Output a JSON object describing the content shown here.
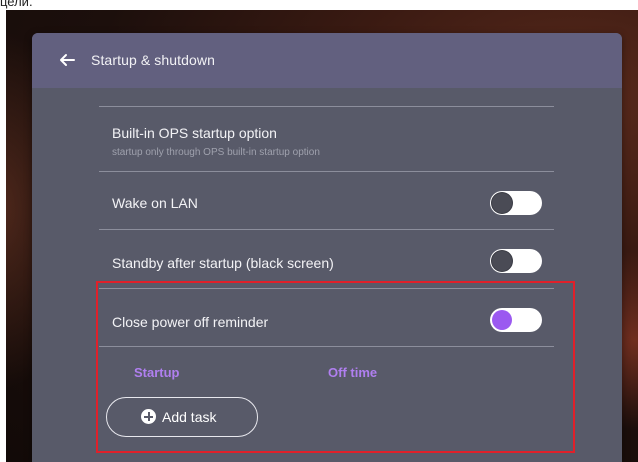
{
  "caption_fragment": "цели.",
  "header": {
    "title": "Startup & shutdown"
  },
  "rows": [
    {
      "title": "Built-in OPS startup option",
      "subtitle": "startup only through OPS built-in startup option"
    },
    {
      "title": "Wake on LAN",
      "toggle": "off"
    },
    {
      "title": "Standby after startup (black screen)",
      "toggle": "off"
    },
    {
      "title": "Close power off reminder",
      "toggle": "on"
    }
  ],
  "schedule": {
    "startup_label": "Startup",
    "off_time_label": "Off time",
    "add_task_label": "Add task"
  },
  "colors": {
    "accent": "#9b59f0",
    "highlight_box": "#e0202a",
    "panel": "#585a69",
    "header": "#62607f"
  },
  "icons": {
    "back": "back-arrow-icon",
    "add": "plus-circle-icon"
  }
}
